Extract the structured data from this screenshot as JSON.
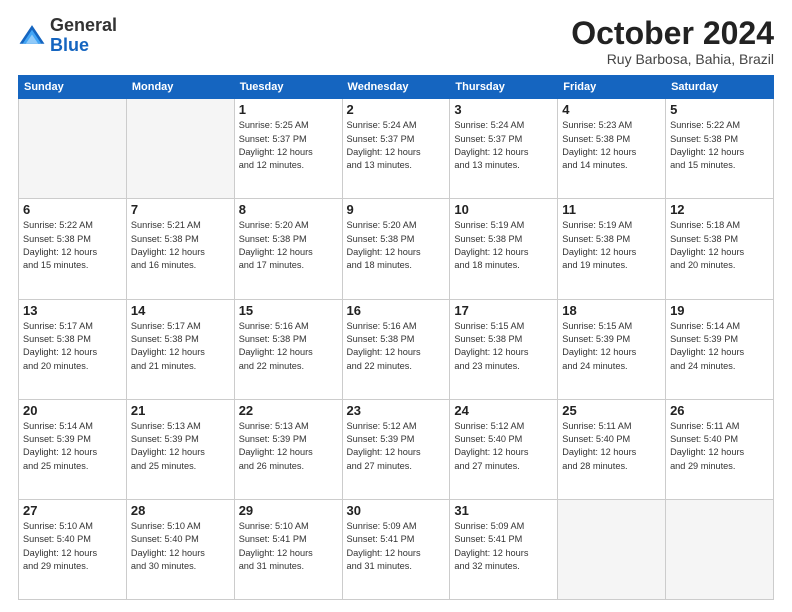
{
  "logo": {
    "general": "General",
    "blue": "Blue"
  },
  "header": {
    "month": "October 2024",
    "location": "Ruy Barbosa, Bahia, Brazil"
  },
  "weekdays": [
    "Sunday",
    "Monday",
    "Tuesday",
    "Wednesday",
    "Thursday",
    "Friday",
    "Saturday"
  ],
  "weeks": [
    [
      {
        "day": "",
        "info": ""
      },
      {
        "day": "",
        "info": ""
      },
      {
        "day": "1",
        "info": "Sunrise: 5:25 AM\nSunset: 5:37 PM\nDaylight: 12 hours\nand 12 minutes."
      },
      {
        "day": "2",
        "info": "Sunrise: 5:24 AM\nSunset: 5:37 PM\nDaylight: 12 hours\nand 13 minutes."
      },
      {
        "day": "3",
        "info": "Sunrise: 5:24 AM\nSunset: 5:37 PM\nDaylight: 12 hours\nand 13 minutes."
      },
      {
        "day": "4",
        "info": "Sunrise: 5:23 AM\nSunset: 5:38 PM\nDaylight: 12 hours\nand 14 minutes."
      },
      {
        "day": "5",
        "info": "Sunrise: 5:22 AM\nSunset: 5:38 PM\nDaylight: 12 hours\nand 15 minutes."
      }
    ],
    [
      {
        "day": "6",
        "info": "Sunrise: 5:22 AM\nSunset: 5:38 PM\nDaylight: 12 hours\nand 15 minutes."
      },
      {
        "day": "7",
        "info": "Sunrise: 5:21 AM\nSunset: 5:38 PM\nDaylight: 12 hours\nand 16 minutes."
      },
      {
        "day": "8",
        "info": "Sunrise: 5:20 AM\nSunset: 5:38 PM\nDaylight: 12 hours\nand 17 minutes."
      },
      {
        "day": "9",
        "info": "Sunrise: 5:20 AM\nSunset: 5:38 PM\nDaylight: 12 hours\nand 18 minutes."
      },
      {
        "day": "10",
        "info": "Sunrise: 5:19 AM\nSunset: 5:38 PM\nDaylight: 12 hours\nand 18 minutes."
      },
      {
        "day": "11",
        "info": "Sunrise: 5:19 AM\nSunset: 5:38 PM\nDaylight: 12 hours\nand 19 minutes."
      },
      {
        "day": "12",
        "info": "Sunrise: 5:18 AM\nSunset: 5:38 PM\nDaylight: 12 hours\nand 20 minutes."
      }
    ],
    [
      {
        "day": "13",
        "info": "Sunrise: 5:17 AM\nSunset: 5:38 PM\nDaylight: 12 hours\nand 20 minutes."
      },
      {
        "day": "14",
        "info": "Sunrise: 5:17 AM\nSunset: 5:38 PM\nDaylight: 12 hours\nand 21 minutes."
      },
      {
        "day": "15",
        "info": "Sunrise: 5:16 AM\nSunset: 5:38 PM\nDaylight: 12 hours\nand 22 minutes."
      },
      {
        "day": "16",
        "info": "Sunrise: 5:16 AM\nSunset: 5:38 PM\nDaylight: 12 hours\nand 22 minutes."
      },
      {
        "day": "17",
        "info": "Sunrise: 5:15 AM\nSunset: 5:38 PM\nDaylight: 12 hours\nand 23 minutes."
      },
      {
        "day": "18",
        "info": "Sunrise: 5:15 AM\nSunset: 5:39 PM\nDaylight: 12 hours\nand 24 minutes."
      },
      {
        "day": "19",
        "info": "Sunrise: 5:14 AM\nSunset: 5:39 PM\nDaylight: 12 hours\nand 24 minutes."
      }
    ],
    [
      {
        "day": "20",
        "info": "Sunrise: 5:14 AM\nSunset: 5:39 PM\nDaylight: 12 hours\nand 25 minutes."
      },
      {
        "day": "21",
        "info": "Sunrise: 5:13 AM\nSunset: 5:39 PM\nDaylight: 12 hours\nand 25 minutes."
      },
      {
        "day": "22",
        "info": "Sunrise: 5:13 AM\nSunset: 5:39 PM\nDaylight: 12 hours\nand 26 minutes."
      },
      {
        "day": "23",
        "info": "Sunrise: 5:12 AM\nSunset: 5:39 PM\nDaylight: 12 hours\nand 27 minutes."
      },
      {
        "day": "24",
        "info": "Sunrise: 5:12 AM\nSunset: 5:40 PM\nDaylight: 12 hours\nand 27 minutes."
      },
      {
        "day": "25",
        "info": "Sunrise: 5:11 AM\nSunset: 5:40 PM\nDaylight: 12 hours\nand 28 minutes."
      },
      {
        "day": "26",
        "info": "Sunrise: 5:11 AM\nSunset: 5:40 PM\nDaylight: 12 hours\nand 29 minutes."
      }
    ],
    [
      {
        "day": "27",
        "info": "Sunrise: 5:10 AM\nSunset: 5:40 PM\nDaylight: 12 hours\nand 29 minutes."
      },
      {
        "day": "28",
        "info": "Sunrise: 5:10 AM\nSunset: 5:40 PM\nDaylight: 12 hours\nand 30 minutes."
      },
      {
        "day": "29",
        "info": "Sunrise: 5:10 AM\nSunset: 5:41 PM\nDaylight: 12 hours\nand 31 minutes."
      },
      {
        "day": "30",
        "info": "Sunrise: 5:09 AM\nSunset: 5:41 PM\nDaylight: 12 hours\nand 31 minutes."
      },
      {
        "day": "31",
        "info": "Sunrise: 5:09 AM\nSunset: 5:41 PM\nDaylight: 12 hours\nand 32 minutes."
      },
      {
        "day": "",
        "info": ""
      },
      {
        "day": "",
        "info": ""
      }
    ]
  ]
}
